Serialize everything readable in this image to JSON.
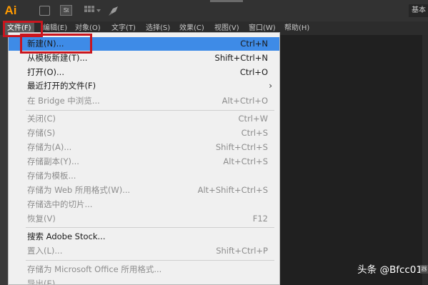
{
  "app": {
    "logo_text": "Ai",
    "st_icon_text": "St",
    "workspace_label": "基本"
  },
  "menubar": {
    "items": [
      "文件(F)",
      "编辑(E)",
      "对象(O)",
      "文字(T)",
      "选择(S)",
      "效果(C)",
      "视图(V)",
      "窗口(W)",
      "帮助(H)"
    ]
  },
  "file_menu": {
    "items": [
      {
        "label": "新建(N)...",
        "shortcut": "Ctrl+N",
        "highlighted": true
      },
      {
        "label": "从模板新建(T)...",
        "shortcut": "Shift+Ctrl+N"
      },
      {
        "label": "打开(O)...",
        "shortcut": "Ctrl+O"
      },
      {
        "label": "最近打开的文件(F)",
        "shortcut": "",
        "submenu": true
      },
      {
        "label": "在 Bridge 中浏览...",
        "shortcut": "Alt+Ctrl+O",
        "disabled": true
      },
      {
        "label": "关闭(C)",
        "shortcut": "Ctrl+W",
        "disabled": true
      },
      {
        "label": "存储(S)",
        "shortcut": "Ctrl+S",
        "disabled": true
      },
      {
        "label": "存储为(A)...",
        "shortcut": "Shift+Ctrl+S",
        "disabled": true
      },
      {
        "label": "存储副本(Y)...",
        "shortcut": "Alt+Ctrl+S",
        "disabled": true
      },
      {
        "label": "存储为模板...",
        "shortcut": "",
        "disabled": true
      },
      {
        "label": "存储为 Web 所用格式(W)...",
        "shortcut": "Alt+Shift+Ctrl+S",
        "disabled": true
      },
      {
        "label": "存储选中的切片...",
        "shortcut": "",
        "disabled": true
      },
      {
        "label": "恢复(V)",
        "shortcut": "F12",
        "disabled": true
      },
      {
        "label": "搜索 Adobe Stock...",
        "shortcut": ""
      },
      {
        "label": "置入(L)...",
        "shortcut": "Shift+Ctrl+P",
        "disabled": true
      },
      {
        "label": "存储为 Microsoft Office 所用格式...",
        "shortcut": "",
        "disabled": true
      },
      {
        "label": "导出(E)",
        "shortcut": "",
        "disabled": true
      }
    ],
    "submenu_arrow": "›"
  },
  "watermark": {
    "text": "头条 @Bfcc01"
  },
  "corner_icon_text": "器"
}
